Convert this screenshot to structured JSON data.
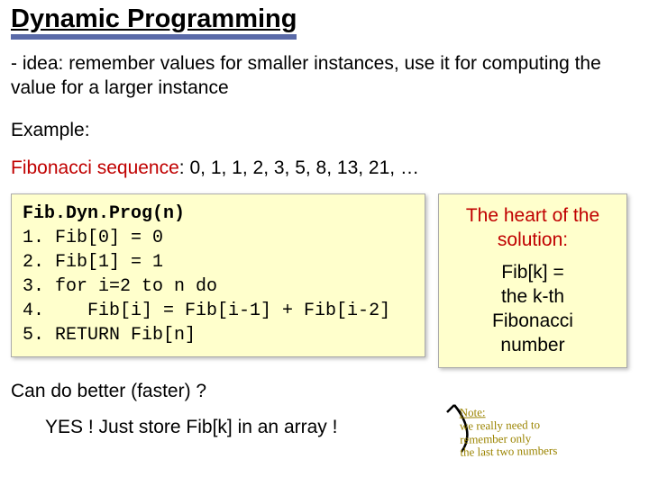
{
  "title": "Dynamic Programming",
  "idea": "- idea: remember values for smaller instances, use it for computing the value for a larger instance",
  "example_label": "Example:",
  "fib": {
    "label": "Fibonacci sequence",
    "colon": ": ",
    "values": "0, 1, 1, 2, 3, 5, 8, 13, 21, …"
  },
  "code": {
    "title": "Fib.Dyn.Prog(n)",
    "lines": [
      "1. Fib[0] = 0",
      "2. Fib[1] = 1",
      "3. for i=2 to n do",
      "4.    Fib[i] = Fib[i-1] + Fib[i-2]",
      "5. RETURN Fib[n]"
    ]
  },
  "side": {
    "heart": "The heart of the solution:",
    "body1": "Fib[k] =",
    "body2": "the k-th",
    "body3": "Fibonacci",
    "body4": "number"
  },
  "better": "Can do better (faster) ?",
  "yes": "YES ! Just store Fib[k] in an array !",
  "note": {
    "title": "Note:",
    "l1": "we really need to",
    "l2": "remember only",
    "l3": "the last two numbers"
  }
}
